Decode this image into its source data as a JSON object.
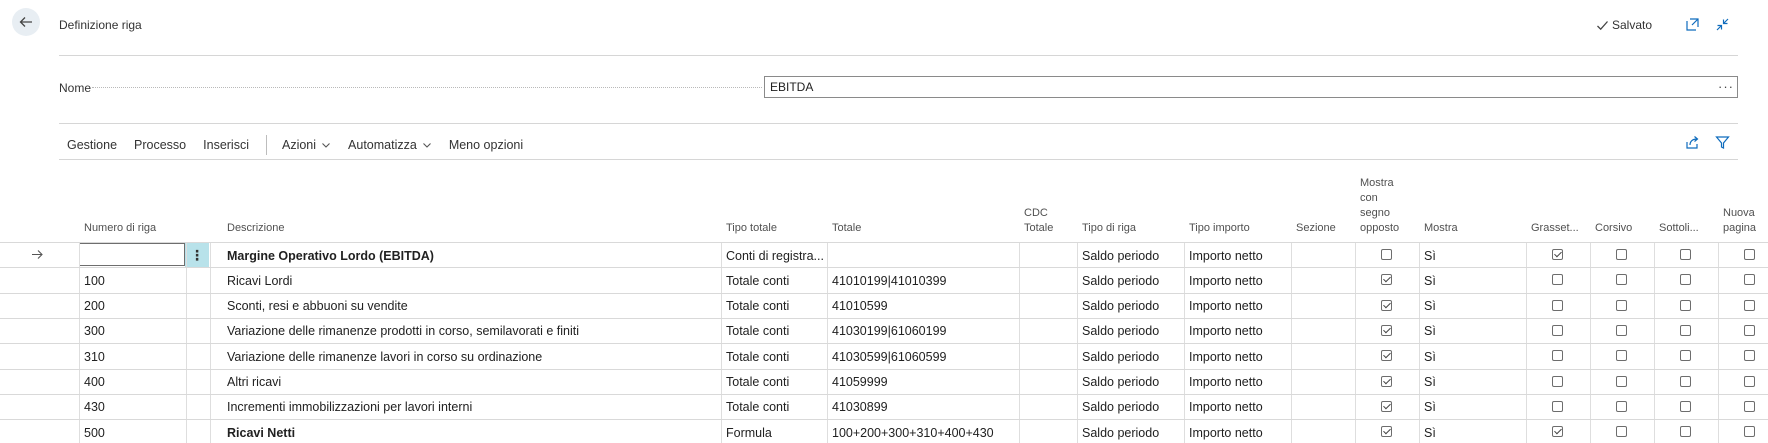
{
  "header": {
    "title": "Definizione riga",
    "saved_label": "Salvato",
    "icons": [
      "back-arrow-icon",
      "check-icon",
      "open-new-window-icon",
      "collapse-icon"
    ]
  },
  "form": {
    "name_label": "Nome",
    "name_value": "EBITDA",
    "more_label": "···"
  },
  "actions": {
    "gestione": "Gestione",
    "processo": "Processo",
    "inserisci": "Inserisci",
    "azioni": "Azioni",
    "automatizza": "Automatizza",
    "meno_opzioni": "Meno opzioni",
    "right_icons": [
      "share-icon",
      "filter-icon"
    ]
  },
  "table": {
    "columns": {
      "numero": "Numero di riga",
      "descrizione": "Descrizione",
      "tipo_totale": "Tipo totale",
      "totale": "Totale",
      "cdc_totale": [
        "CDC",
        "Totale"
      ],
      "tipo_riga": "Tipo di riga",
      "tipo_importo": "Tipo importo",
      "sezione": "Sezione",
      "segno_opposto": [
        "Mostra",
        "con",
        "segno",
        "opposto"
      ],
      "mostra": "Mostra",
      "grassetto": "Grasset...",
      "corsivo": "Corsivo",
      "sottolineato": "Sottoli...",
      "nuova_pagina": [
        "Nuova",
        "pagina"
      ]
    },
    "rows": [
      {
        "numero": "",
        "descrizione": "Margine Operativo Lordo (EBITDA)",
        "tipo_totale": "Conti di registra...",
        "totale": "",
        "cdc": "",
        "tipo_riga": "Saldo periodo",
        "tipo_importo": "Importo netto",
        "sezione": "",
        "segno_opposto": false,
        "mostra": "Sì",
        "grassetto": true,
        "corsivo": false,
        "sottolineato": false,
        "nuova_pagina": false,
        "bold": true
      },
      {
        "numero": "100",
        "descrizione": "Ricavi Lordi",
        "tipo_totale": "Totale conti",
        "totale": "41010199|41010399",
        "cdc": "",
        "tipo_riga": "Saldo periodo",
        "tipo_importo": "Importo netto",
        "sezione": "",
        "segno_opposto": true,
        "mostra": "Sì",
        "grassetto": false,
        "corsivo": false,
        "sottolineato": false,
        "nuova_pagina": false,
        "bold": false
      },
      {
        "numero": "200",
        "descrizione": "Sconti, resi e abbuoni su vendite",
        "tipo_totale": "Totale conti",
        "totale": "41010599",
        "cdc": "",
        "tipo_riga": "Saldo periodo",
        "tipo_importo": "Importo netto",
        "sezione": "",
        "segno_opposto": true,
        "mostra": "Sì",
        "grassetto": false,
        "corsivo": false,
        "sottolineato": false,
        "nuova_pagina": false,
        "bold": false
      },
      {
        "numero": "300",
        "descrizione": "Variazione delle rimanenze prodotti in corso, semilavorati e finiti",
        "tipo_totale": "Totale conti",
        "totale": "41030199|61060199",
        "cdc": "",
        "tipo_riga": "Saldo periodo",
        "tipo_importo": "Importo netto",
        "sezione": "",
        "segno_opposto": true,
        "mostra": "Sì",
        "grassetto": false,
        "corsivo": false,
        "sottolineato": false,
        "nuova_pagina": false,
        "bold": false
      },
      {
        "numero": "310",
        "descrizione": "Variazione delle rimanenze lavori in corso su ordinazione",
        "tipo_totale": "Totale conti",
        "totale": "41030599|61060599",
        "cdc": "",
        "tipo_riga": "Saldo periodo",
        "tipo_importo": "Importo netto",
        "sezione": "",
        "segno_opposto": true,
        "mostra": "Sì",
        "grassetto": false,
        "corsivo": false,
        "sottolineato": false,
        "nuova_pagina": false,
        "bold": false
      },
      {
        "numero": "400",
        "descrizione": "Altri ricavi",
        "tipo_totale": "Totale conti",
        "totale": "41059999",
        "cdc": "",
        "tipo_riga": "Saldo periodo",
        "tipo_importo": "Importo netto",
        "sezione": "",
        "segno_opposto": true,
        "mostra": "Sì",
        "grassetto": false,
        "corsivo": false,
        "sottolineato": false,
        "nuova_pagina": false,
        "bold": false
      },
      {
        "numero": "430",
        "descrizione": "Incrementi immobilizzazioni per lavori interni",
        "tipo_totale": "Totale conti",
        "totale": "41030899",
        "cdc": "",
        "tipo_riga": "Saldo periodo",
        "tipo_importo": "Importo netto",
        "sezione": "",
        "segno_opposto": true,
        "mostra": "Sì",
        "grassetto": false,
        "corsivo": false,
        "sottolineato": false,
        "nuova_pagina": false,
        "bold": false
      },
      {
        "numero": "500",
        "descrizione": "Ricavi Netti",
        "tipo_totale": "Formula",
        "totale": "100+200+300+310+400+430",
        "cdc": "",
        "tipo_riga": "Saldo periodo",
        "tipo_importo": "Importo netto",
        "sezione": "",
        "segno_opposto": true,
        "mostra": "Sì",
        "grassetto": true,
        "corsivo": false,
        "sottolineato": false,
        "nuova_pagina": false,
        "bold": true
      }
    ]
  },
  "colors": {
    "accent": "#0f6cbd",
    "kebab_bg": "#b8e2ea",
    "back_bg": "#e8eef3"
  }
}
